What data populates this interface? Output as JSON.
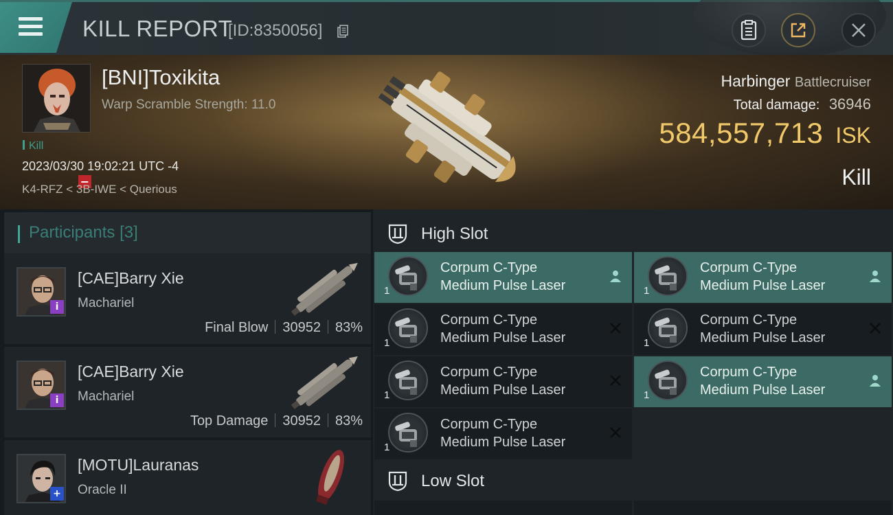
{
  "header": {
    "title": "KILL REPORT",
    "id_text": "[ID:8350056]",
    "buttons": [
      {
        "icon": "clipboard-icon"
      },
      {
        "icon": "share-export-icon"
      },
      {
        "icon": "close-icon"
      }
    ]
  },
  "victim": {
    "name": "[BNI]Toxikita",
    "detail": "Warp Scramble Strength: 11.0",
    "tag": "Kill",
    "date": "2023/03/30 19:02:21 UTC -4",
    "location": "K4-RFZ < 3B-IWE < Querious",
    "ship_name": "Harbinger",
    "ship_class": "Battlecruiser",
    "total_damage_label": "Total damage:",
    "total_damage": "36946",
    "isk_value": "584,557,713",
    "isk_unit": "ISK",
    "result": "Kill"
  },
  "participants": {
    "title": "Participants",
    "count": "[3]",
    "rows": [
      {
        "name": "[CAE]Barry Xie",
        "ship": "Machariel",
        "role": "Final Blow",
        "damage": "30952",
        "percent": "83%",
        "badge": "i"
      },
      {
        "name": "[CAE]Barry Xie",
        "ship": "Machariel",
        "role": "Top Damage",
        "damage": "30952",
        "percent": "83%",
        "badge": "i"
      },
      {
        "name": "[MOTU]Lauranas",
        "ship": "Oracle II",
        "role": "",
        "damage": "",
        "percent": "",
        "badge": "+"
      }
    ]
  },
  "slots": {
    "high_label": "High Slot",
    "low_label": "Low Slot",
    "modules": [
      {
        "line1": "Corpum C-Type",
        "line2": "Medium Pulse Laser",
        "qty": "1",
        "state": "person-icon"
      },
      {
        "line1": "Corpum C-Type",
        "line2": "Medium Pulse Laser",
        "qty": "1",
        "state": "person-icon"
      },
      {
        "line1": "Corpum C-Type",
        "line2": "Medium Pulse Laser",
        "qty": "1",
        "state": "destroyed-x-icon"
      },
      {
        "line1": "Corpum C-Type",
        "line2": "Medium Pulse Laser",
        "qty": "1",
        "state": "destroyed-x-icon"
      },
      {
        "line1": "Corpum C-Type",
        "line2": "Medium Pulse Laser",
        "qty": "1",
        "state": "destroyed-x-icon"
      },
      {
        "line1": "Corpum C-Type",
        "line2": "Medium Pulse Laser",
        "qty": "1",
        "state": "person-icon"
      },
      {
        "line1": "Corpum C-Type",
        "line2": "Medium Pulse Laser",
        "qty": "1",
        "state": "destroyed-x-icon"
      }
    ]
  },
  "colors": {
    "accent_teal": "#3fa897",
    "isk_gold": "#f1c96a",
    "highlight_row": "#3b6b64"
  }
}
